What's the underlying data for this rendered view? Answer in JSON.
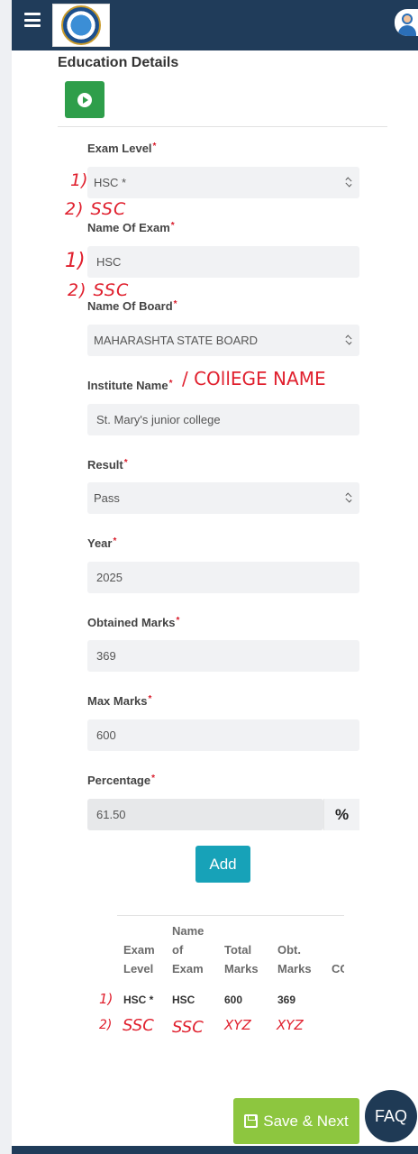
{
  "header": {
    "logo_icon": "college-seal-logo",
    "menu_icon": "hamburger-icon",
    "profile_icon": "user-avatar-icon",
    "background": "#203c5a"
  },
  "section": {
    "title": "Education Details",
    "play_icon": "play-icon"
  },
  "form": {
    "required_mark": "*",
    "exam_level": {
      "label": "Exam Level",
      "value": "HSC *"
    },
    "name_of_exam": {
      "label": "Name Of Exam",
      "value": "HSC"
    },
    "name_of_board": {
      "label": "Name Of Board",
      "value": "MAHARASHTA STATE BOARD"
    },
    "institute_name": {
      "label": "Institute Name",
      "value": "St. Mary's junior college"
    },
    "result": {
      "label": "Result",
      "value": "Pass"
    },
    "year": {
      "label": "Year",
      "value": "2025"
    },
    "obtained_marks": {
      "label": "Obtained Marks",
      "value": "369"
    },
    "max_marks": {
      "label": "Max Marks",
      "value": "600"
    },
    "percentage": {
      "label": "Percentage",
      "value": "61.50",
      "addon": "%"
    },
    "add_label": "Add"
  },
  "table": {
    "headers": [
      [
        "Exam",
        "Level"
      ],
      [
        "Name",
        "of",
        "Exam"
      ],
      [
        "Total",
        "Marks"
      ],
      [
        "Obt.",
        "Marks"
      ],
      [
        "CC"
      ]
    ],
    "rows": [
      {
        "exam_level": "HSC *",
        "name_of_exam": "HSC",
        "total_marks": "600",
        "obt_marks": "369"
      }
    ]
  },
  "annotations": {
    "exam_level_1": "1)",
    "exam_level_2": "2) SSC",
    "name_of_exam_1": "1)",
    "name_of_exam_2": "2) SSC",
    "institute": "/ COllEGE NAME",
    "row_1": "1)",
    "row_2_num": "2)",
    "row_2_level": "SSC",
    "row_2_exam": "SSC",
    "row_2_total": "XYZ",
    "row_2_obt": "XYZ",
    "ink_color": "#e0202e"
  },
  "footer": {
    "save_label": "Save & Next",
    "save_icon": "save-icon",
    "faq_label": "FAQ"
  }
}
